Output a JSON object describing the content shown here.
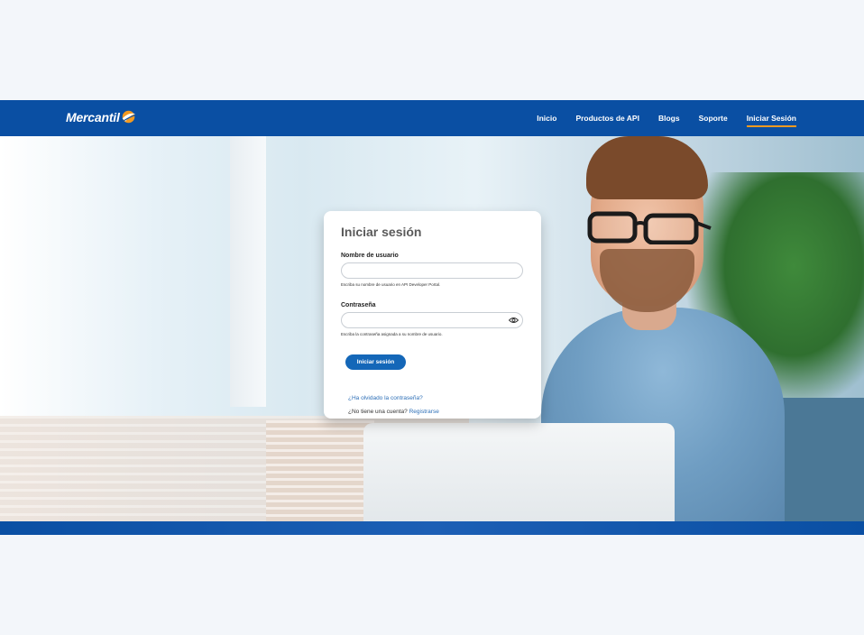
{
  "brand": {
    "name": "Mercantil",
    "colors": {
      "primary": "#0a4fa3",
      "accent": "#f39a21",
      "button": "#1467b8",
      "link": "#2d6fb7"
    }
  },
  "nav": {
    "items": [
      {
        "label": "Inicio",
        "active": false
      },
      {
        "label": "Productos de API",
        "active": false
      },
      {
        "label": "Blogs",
        "active": false
      },
      {
        "label": "Soporte",
        "active": false
      },
      {
        "label": "Iniciar Sesión",
        "active": true
      }
    ]
  },
  "login": {
    "title": "Iniciar sesión",
    "username": {
      "label": "Nombre de usuario",
      "value": "",
      "placeholder": "",
      "helper": "Escriba su nombre de usuario en API Developer Portal."
    },
    "password": {
      "label": "Contraseña",
      "value": "",
      "placeholder": "",
      "helper": "Escriba la contraseña asignada a su nombre de usuario.",
      "toggle_icon": "eye-icon"
    },
    "submit_label": "Iniciar sesión",
    "forgot_link": "¿Ha olvidado la contraseña?",
    "register_prompt": "¿No tiene una cuenta?",
    "register_link": "Registrarse"
  }
}
